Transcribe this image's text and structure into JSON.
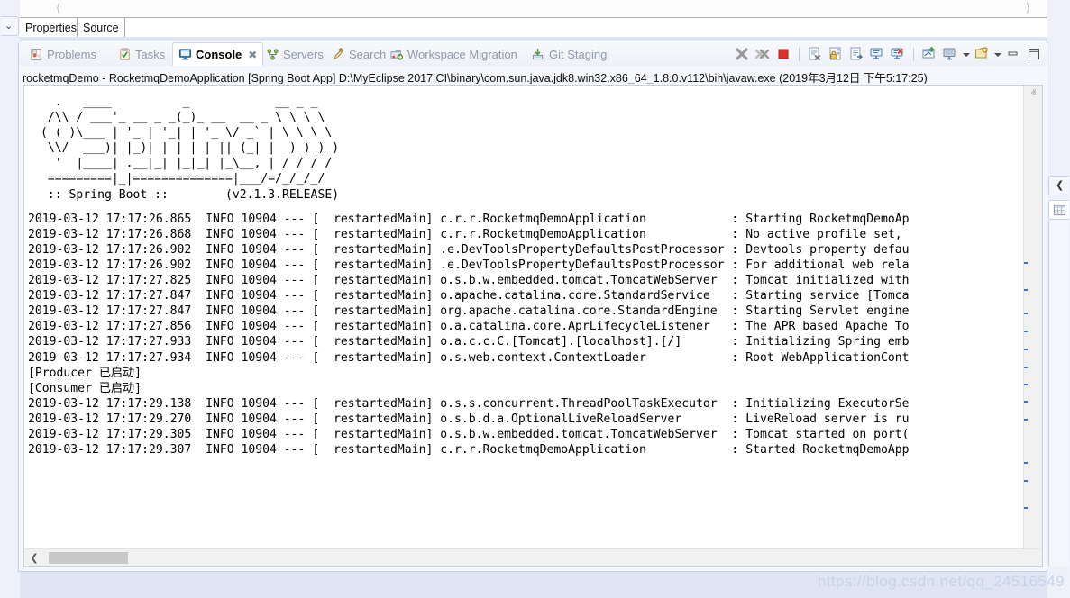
{
  "editor": {
    "nav_left_icon": "chevron-left-icon",
    "nav_right_icon": "chevron-right-icon",
    "tabs": [
      {
        "label": "Properties",
        "active": false
      },
      {
        "label": "Source",
        "active": true
      }
    ]
  },
  "view_tabs": [
    {
      "label": "Problems",
      "icon": "problems-icon",
      "active": false
    },
    {
      "label": "Tasks",
      "icon": "tasks-icon",
      "active": false
    },
    {
      "label": "Console",
      "icon": "console-icon",
      "active": true,
      "close": "✖"
    },
    {
      "label": "Servers",
      "icon": "servers-icon",
      "active": false
    },
    {
      "label": "Search",
      "icon": "search-icon",
      "active": false
    },
    {
      "label": "Workspace Migration",
      "icon": "workspace-migration-icon",
      "active": false
    },
    {
      "label": "Git Staging",
      "icon": "git-staging-icon",
      "active": false
    }
  ],
  "toolbar": [
    {
      "name": "terminate-icon",
      "tip": "Terminate"
    },
    {
      "name": "remove-all-terminated-icon",
      "tip": "Remove All Terminated Launches"
    },
    {
      "name": "stop-icon",
      "tip": "Stop"
    },
    {
      "name": "separator-1",
      "tip": ""
    },
    {
      "name": "clear-console-icon",
      "tip": "Clear Console"
    },
    {
      "name": "scroll-lock-icon",
      "tip": "Scroll Lock"
    },
    {
      "name": "word-wrap-icon",
      "tip": "Word Wrap"
    },
    {
      "name": "show-console-on-output-icon",
      "tip": "Show Console When Standard Out Changes"
    },
    {
      "name": "show-console-on-error-icon",
      "tip": "Show Console When Standard Error Changes"
    },
    {
      "name": "separator-2",
      "tip": ""
    },
    {
      "name": "pin-console-icon",
      "tip": "Pin Console"
    },
    {
      "name": "display-selected-console-icon",
      "tip": "Display Selected Console"
    },
    {
      "name": "display-selected-console-caret",
      "tip": ""
    },
    {
      "name": "open-console-icon",
      "tip": "Open Console"
    },
    {
      "name": "open-console-caret",
      "tip": ""
    },
    {
      "name": "minimize-icon",
      "tip": "Minimize"
    },
    {
      "name": "maximize-icon",
      "tip": "Maximize"
    }
  ],
  "console": {
    "title": "rocketmqDemo - RocketmqDemoApplication [Spring Boot App] D:\\MyEclipse 2017 CI\\binary\\com.sun.java.jdk8.win32.x86_64_1.8.0.v112\\bin\\javaw.exe (2019年3月12日 下午5:17:25)",
    "banner": "  .   ____          _            __ _ _\n /\\\\ / ___'_ __ _ _(_)_ __  __ _ \\ \\ \\ \\\n( ( )\\___ | '_ | '_| | '_ \\/ _` | \\ \\ \\ \\\n \\\\/  ___)| |_)| | | | | || (_| |  ) ) ) )\n  '  |____| .__|_| |_|_| |_\\__, | / / / /\n =========|_|==============|___/=/_/_/_/",
    "banner_footer": " :: Spring Boot ::        (v2.1.3.RELEASE)",
    "log_lines": [
      "2019-03-12 17:17:26.865  INFO 10904 --- [  restartedMain] c.r.r.RocketmqDemoApplication            : Starting RocketmqDemoAp",
      "2019-03-12 17:17:26.868  INFO 10904 --- [  restartedMain] c.r.r.RocketmqDemoApplication            : No active profile set,",
      "2019-03-12 17:17:26.902  INFO 10904 --- [  restartedMain] .e.DevToolsPropertyDefaultsPostProcessor : Devtools property defau",
      "2019-03-12 17:17:26.902  INFO 10904 --- [  restartedMain] .e.DevToolsPropertyDefaultsPostProcessor : For additional web rela",
      "2019-03-12 17:17:27.825  INFO 10904 --- [  restartedMain] o.s.b.w.embedded.tomcat.TomcatWebServer  : Tomcat initialized with",
      "2019-03-12 17:17:27.847  INFO 10904 --- [  restartedMain] o.apache.catalina.core.StandardService   : Starting service [Tomca",
      "2019-03-12 17:17:27.847  INFO 10904 --- [  restartedMain] org.apache.catalina.core.StandardEngine  : Starting Servlet engine",
      "2019-03-12 17:17:27.856  INFO 10904 --- [  restartedMain] o.a.catalina.core.AprLifecycleListener   : The APR based Apache To",
      "2019-03-12 17:17:27.933  INFO 10904 --- [  restartedMain] o.a.c.c.C.[Tomcat].[localhost].[/]       : Initializing Spring emb",
      "2019-03-12 17:17:27.934  INFO 10904 --- [  restartedMain] o.s.web.context.ContextLoader            : Root WebApplicationCont",
      "[Producer 已启动]",
      "[Consumer 已启动]",
      "2019-03-12 17:17:29.138  INFO 10904 --- [  restartedMain] o.s.s.concurrent.ThreadPoolTaskExecutor  : Initializing ExecutorSe",
      "2019-03-12 17:17:29.270  INFO 10904 --- [  restartedMain] o.s.b.d.a.OptionalLiveReloadServer       : LiveReload server is ru",
      "2019-03-12 17:17:29.305  INFO 10904 --- [  restartedMain] o.s.b.w.embedded.tomcat.TomcatWebServer  : Tomcat started on port(",
      "2019-03-12 17:17:29.307  INFO 10904 --- [  restartedMain] c.r.r.RocketmqDemoApplication            : Started RocketmqDemoApp"
    ],
    "vscroll": {
      "up_arrow": "ⱏ",
      "down_arrow": "ⱟ",
      "marker_color": "#3b6fd4",
      "markers_y": [
        196,
        226,
        252,
        272,
        292,
        312,
        331,
        350,
        370,
        418,
        438,
        468
      ]
    },
    "hscroll": {
      "left_arrow": "❮"
    }
  },
  "rails": {
    "left_chevron": "⌄",
    "right_chevron": "❮",
    "right_panel_icon": "table-view-icon"
  },
  "watermark": "https://blog.csdn.net/qq_24516549",
  "colors": {
    "panel_bg": "#eef1f9",
    "console_bg": "#ffffff",
    "accent_blue": "#3b6fd4",
    "text": "#000000",
    "tab_inactive_text": "#8f99ab"
  }
}
